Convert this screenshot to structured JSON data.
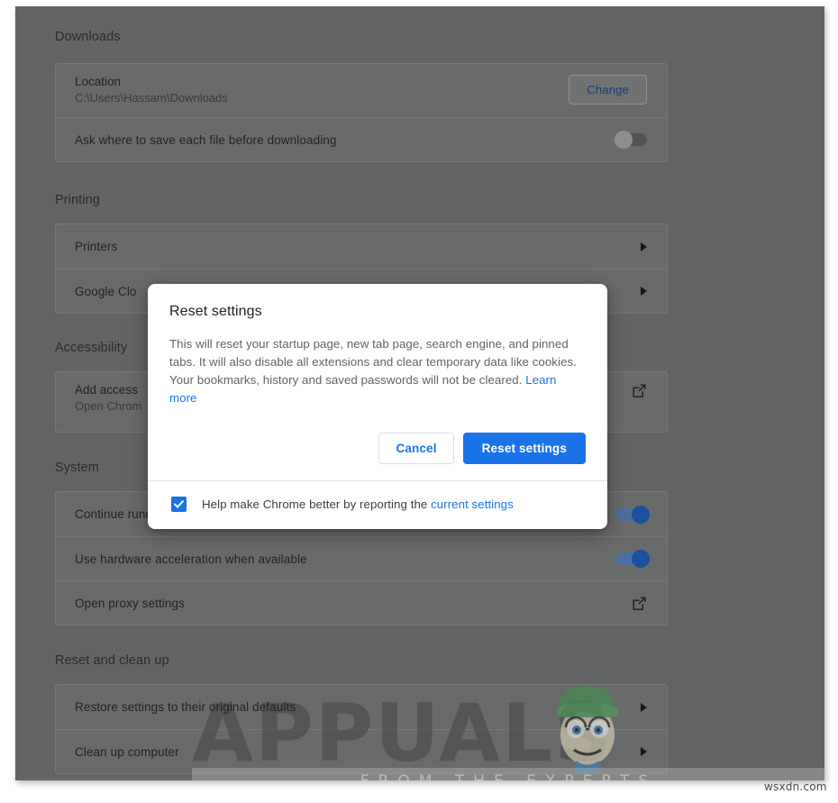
{
  "watermark": {
    "brand": "APPUALS",
    "tagline": "FROM THE EXPERTS",
    "domain": "wsxdn.com"
  },
  "sections": [
    {
      "title": "Downloads",
      "rows": [
        {
          "primary": "Location",
          "secondary": "C:\\Users\\Hassam\\Downloads",
          "control": "button",
          "control_label": "Change"
        },
        {
          "primary": "Ask where to save each file before downloading",
          "control": "toggle",
          "control_state": "off"
        }
      ]
    },
    {
      "title": "Printing",
      "rows": [
        {
          "primary": "Printers",
          "control": "arrow"
        },
        {
          "primary": "Google Clo",
          "control": "arrow"
        }
      ]
    },
    {
      "title": "Accessibility",
      "rows": [
        {
          "primary": "Add access",
          "secondary": "Open Chrom",
          "control": "external-link"
        }
      ]
    },
    {
      "title": "System",
      "rows": [
        {
          "primary": "Continue running background apps when Google Chrome is closed",
          "control": "toggle",
          "control_state": "on"
        },
        {
          "primary": "Use hardware acceleration when available",
          "control": "toggle",
          "control_state": "on"
        },
        {
          "primary": "Open proxy settings",
          "control": "external-link"
        }
      ]
    },
    {
      "title": "Reset and clean up",
      "rows": [
        {
          "primary": "Restore settings to their original defaults",
          "control": "arrow"
        },
        {
          "primary": "Clean up computer",
          "control": "arrow"
        }
      ]
    }
  ],
  "dialog": {
    "title": "Reset settings",
    "body": "This will reset your startup page, new tab page, search engine, and pinned tabs. It will also disable all extensions and clear temporary data like cookies. Your bookmarks, history and saved passwords will not be cleared. ",
    "learn_more": "Learn more",
    "cancel_label": "Cancel",
    "confirm_label": "Reset settings",
    "footer_text": "Help make Chrome better by reporting the ",
    "footer_link": "current settings",
    "checkbox_checked": true
  },
  "colors": {
    "accent": "#1a73e8",
    "overlay": "#636565",
    "dialog_bg": "#ffffff",
    "toggle_on": "#1d4fa0",
    "toggle_off": "#8d8e8e"
  }
}
